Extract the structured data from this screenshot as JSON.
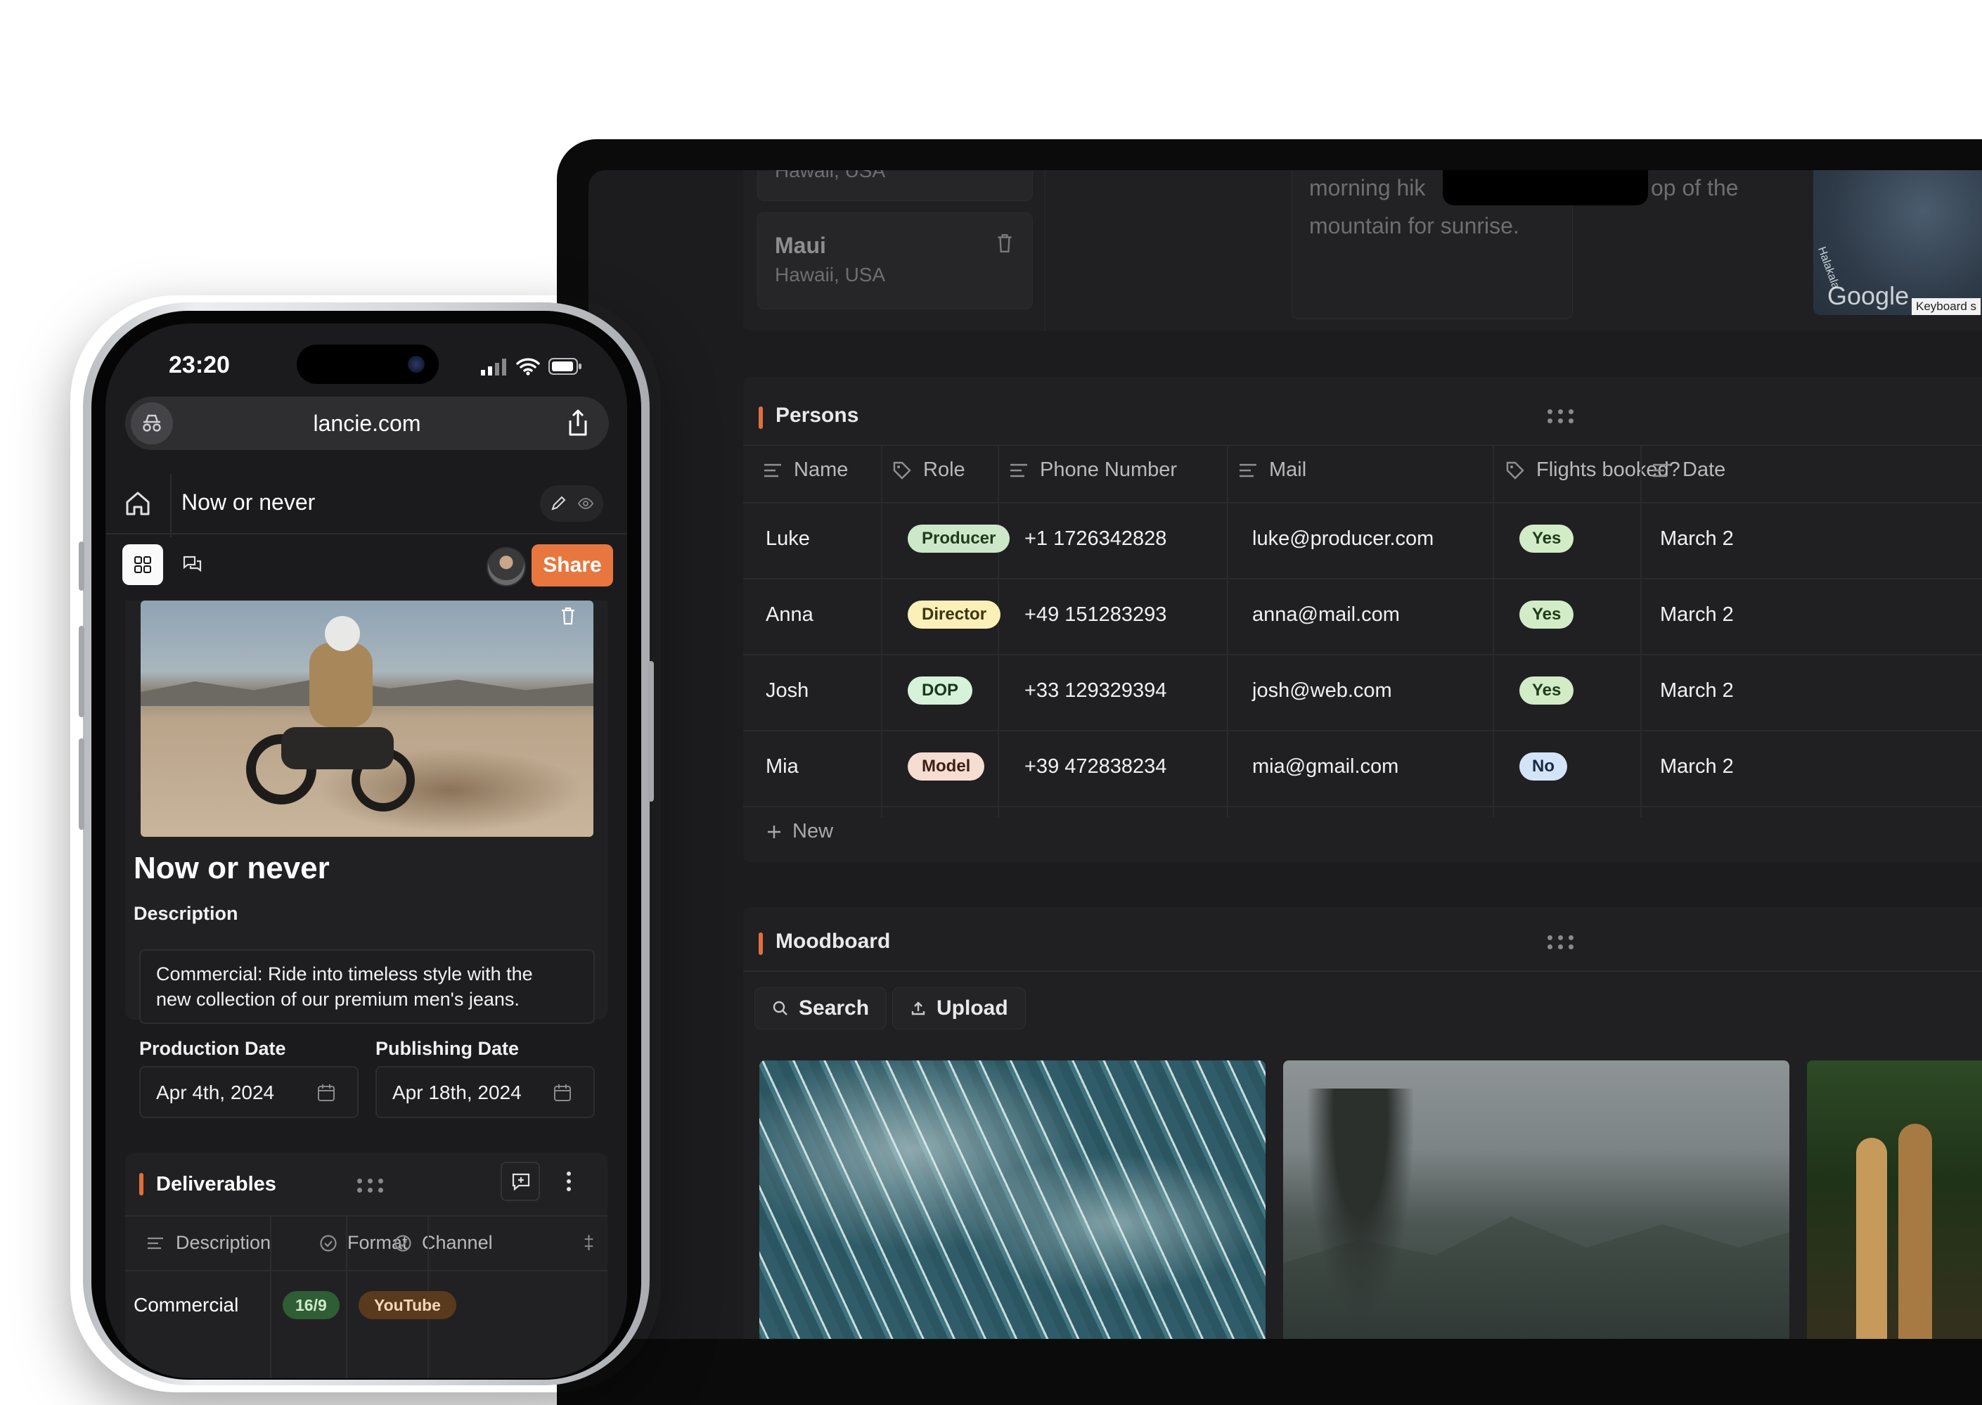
{
  "laptop": {
    "locations": {
      "prev_location_partial": "Hawaii, USA",
      "card": {
        "name": "Maui",
        "region": "Hawaii, USA"
      },
      "note_line1": "morning hik",
      "note_line1_tail": "op of the",
      "note_line2": "mountain for sunrise.",
      "map_brand": "Google",
      "map_keyboard": "Keyboard s",
      "map_label": "Halakala"
    },
    "persons": {
      "title": "Persons",
      "columns": [
        "Name",
        "Role",
        "Phone Number",
        "Mail",
        "Flights booked?",
        "Date"
      ],
      "rows": [
        {
          "name": "Luke",
          "role": "Producer",
          "phone": "+1 1726342828",
          "mail": "luke@producer.com",
          "flights": "Yes",
          "date": "March 2"
        },
        {
          "name": "Anna",
          "role": "Director",
          "phone": "+49 151283293",
          "mail": "anna@mail.com",
          "flights": "Yes",
          "date": "March 2"
        },
        {
          "name": "Josh",
          "role": "DOP",
          "phone": "+33 129329394",
          "mail": "josh@web.com",
          "flights": "Yes",
          "date": "March 2"
        },
        {
          "name": "Mia",
          "role": "Model",
          "phone": "+39 472838234",
          "mail": "mia@gmail.com",
          "flights": "No",
          "date": "March 2"
        }
      ],
      "new_label": "New",
      "role_colors": {
        "Producer": "#cde8c9",
        "Director": "#fbf0b8",
        "DOP": "#d6f3da",
        "Model": "#f6ddd2"
      },
      "flight_colors": {
        "Yes": "#d3ecc8",
        "No": "#d4e4f8"
      }
    },
    "moodboard": {
      "title": "Moodboard",
      "search_label": "Search",
      "upload_label": "Upload"
    }
  },
  "phone": {
    "status": {
      "time": "23:20"
    },
    "browser": {
      "url": "lancie.com"
    },
    "header": {
      "title": "Now or never"
    },
    "toolbar": {
      "share_label": "Share"
    },
    "project": {
      "title": "Now or never",
      "description_label": "Description",
      "description": "Commercial: Ride into timeless style with the new collection of our premium men's jeans.",
      "description_line1": "Commercial: Ride into timeless style with the",
      "description_line2": "new collection of our premium men's jeans.",
      "production_date_label": "Production Date",
      "production_date": "Apr 4th, 2024",
      "publishing_date_label": "Publishing Date",
      "publishing_date": "Apr 18th, 2024"
    },
    "deliverables": {
      "title": "Deliverables",
      "columns": [
        "Description",
        "Format",
        "Channel"
      ],
      "rows": [
        {
          "description": "Commercial",
          "format": "16/9",
          "channel": "YouTube"
        }
      ]
    }
  },
  "colors": {
    "accent": "#e0703a",
    "share_button": "#e8763f",
    "laptop_bg": "#1c1c1e",
    "phone_bg": "#1b1b1d"
  }
}
